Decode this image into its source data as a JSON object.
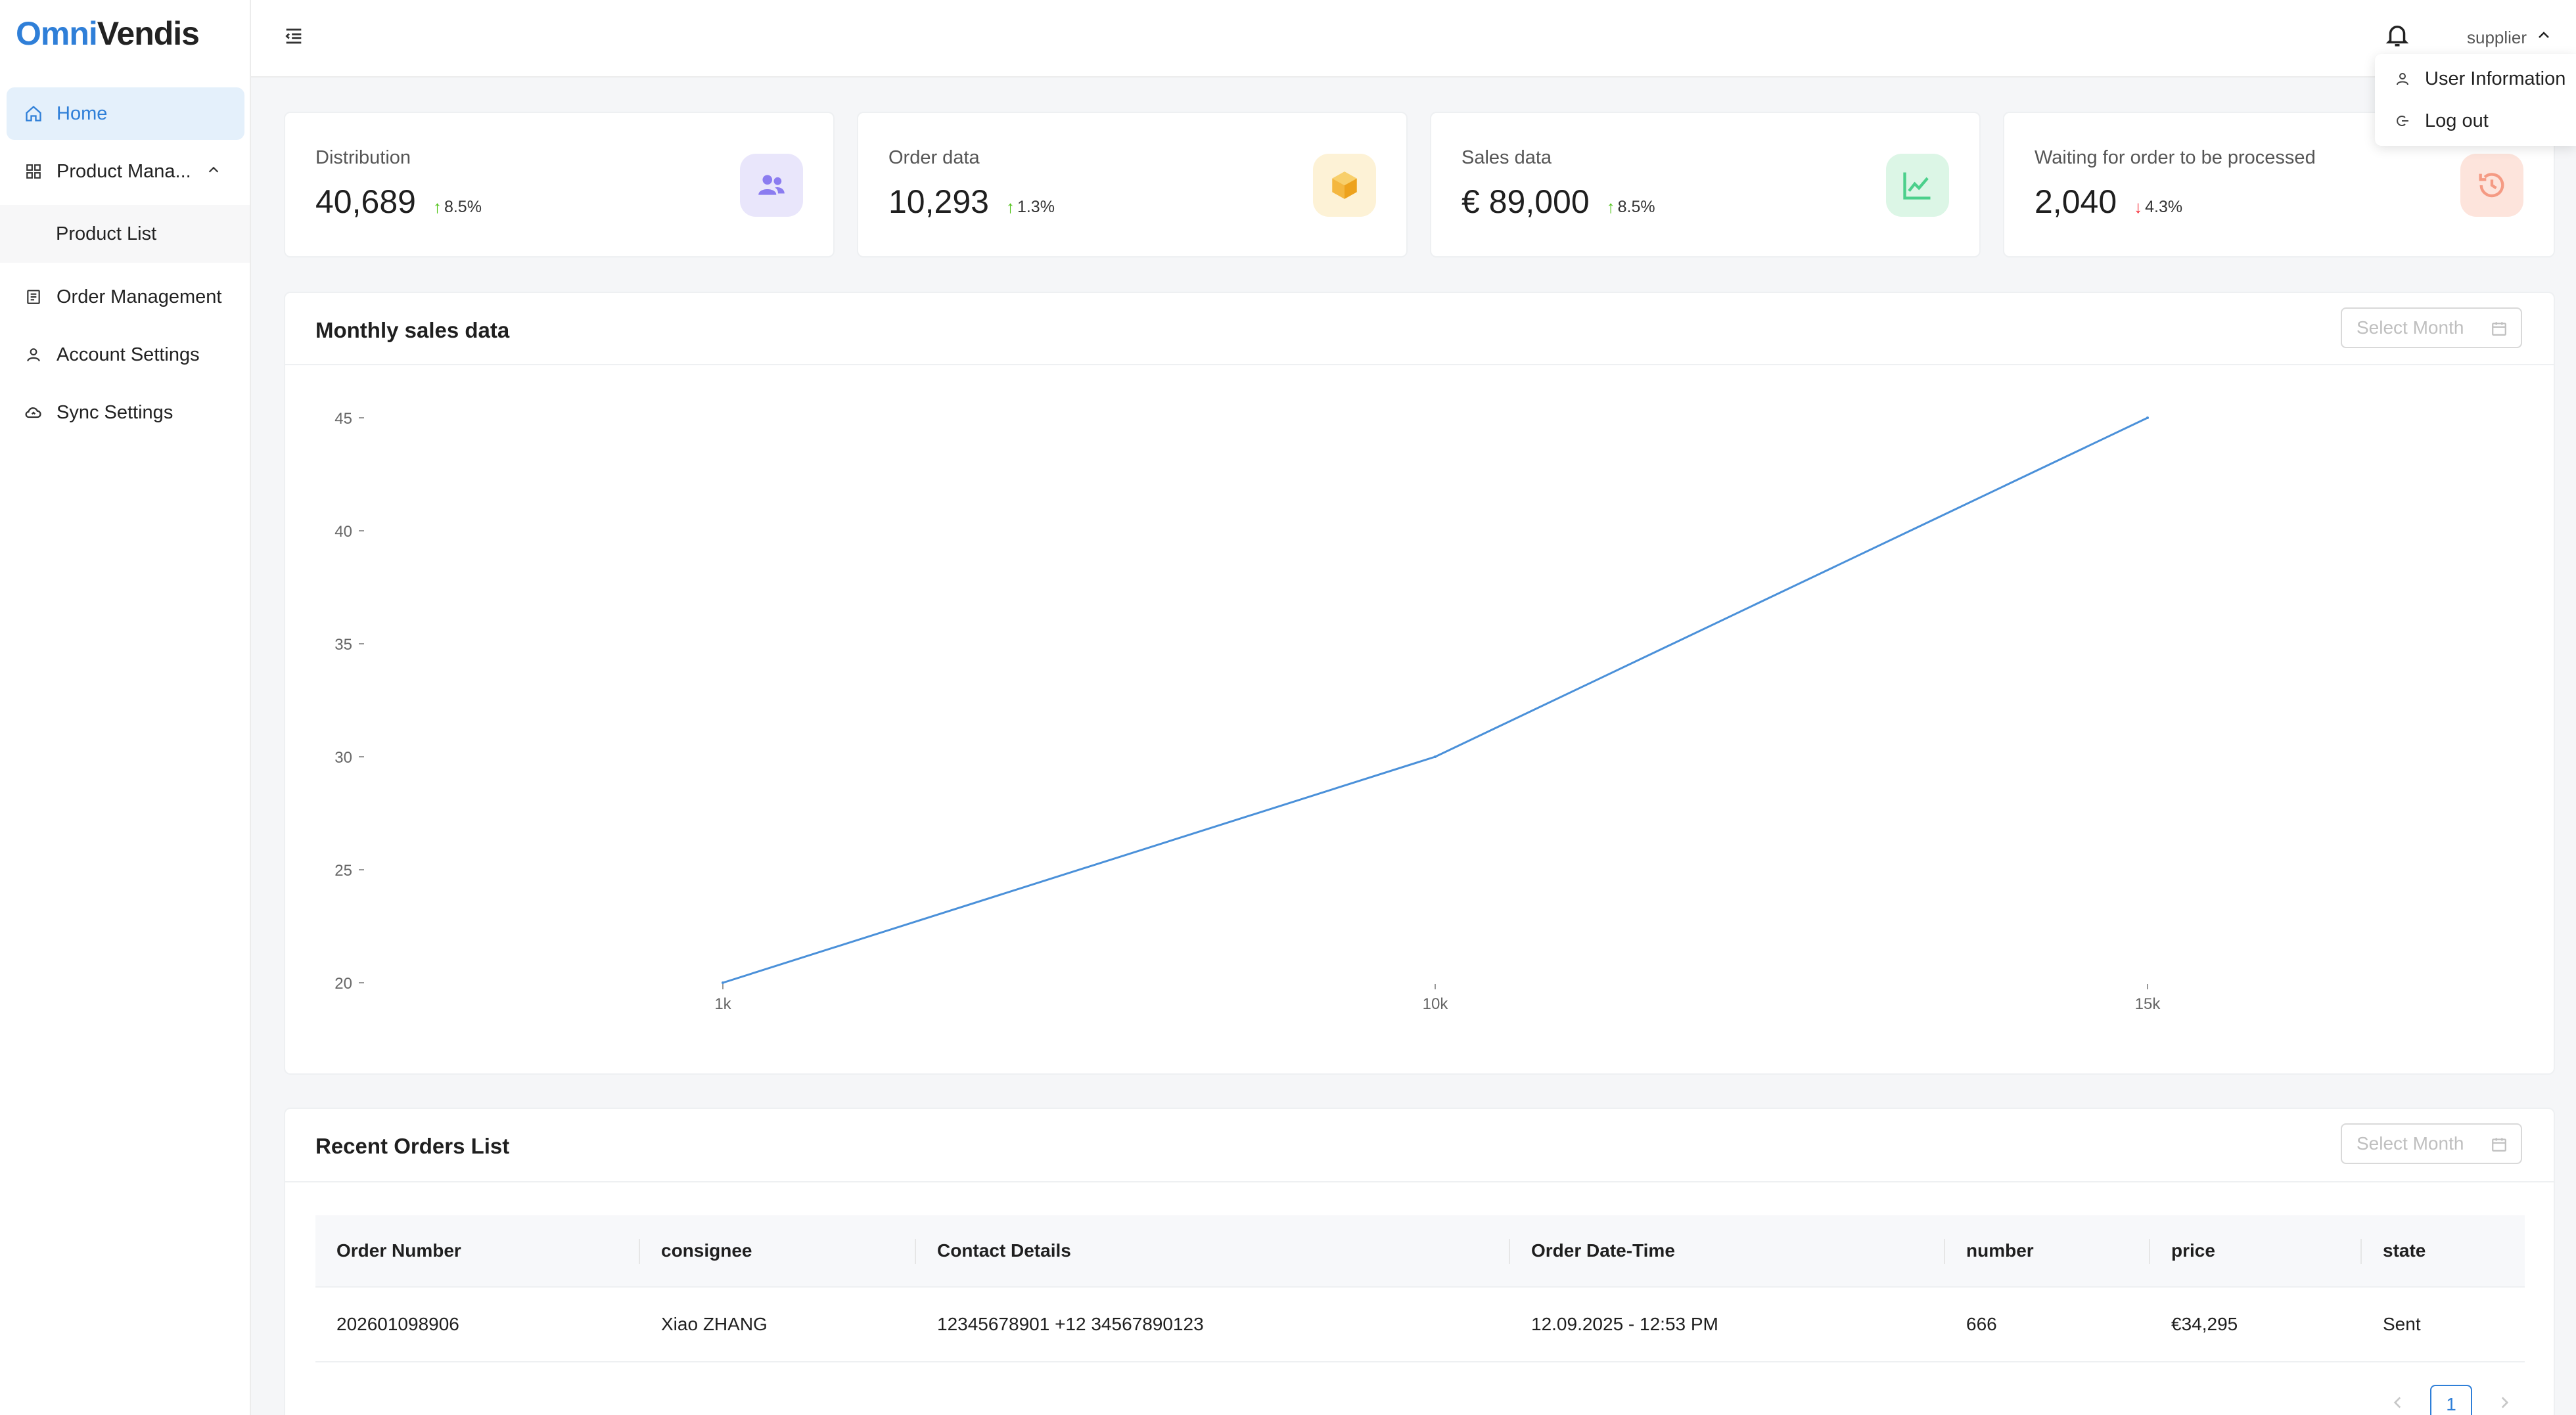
{
  "brand": {
    "part1": "Omni",
    "part2": "Vendis"
  },
  "sidebar": {
    "items": [
      {
        "label": "Home",
        "icon": "home-icon"
      },
      {
        "label": "Product Mana...",
        "icon": "grid-icon"
      },
      {
        "label": "Product List"
      },
      {
        "label": "Order Management",
        "icon": "document-icon"
      },
      {
        "label": "Account Settings",
        "icon": "user-icon"
      },
      {
        "label": "Sync Settings",
        "icon": "cloud-sync-icon"
      }
    ]
  },
  "header": {
    "user": "supplier",
    "dropdown": [
      {
        "label": "User Information",
        "icon": "user-icon"
      },
      {
        "label": "Log out",
        "icon": "logout-icon"
      }
    ]
  },
  "stats": [
    {
      "label": "Distribution",
      "value": "40,689",
      "delta": "8.5%",
      "direction": "up",
      "icon": "users-icon",
      "bg": "#e9e6fb",
      "fg": "#8b7cf0"
    },
    {
      "label": "Order data",
      "value": "10,293",
      "delta": "1.3%",
      "direction": "up",
      "icon": "box-icon",
      "bg": "#fdf2d6",
      "fg": "#f4b740"
    },
    {
      "label": "Sales data",
      "value": "€ 89,000",
      "delta": "8.5%",
      "direction": "up",
      "icon": "chart-line-icon",
      "bg": "#dcf6e6",
      "fg": "#4bd08b"
    },
    {
      "label": "Waiting for order to be processed",
      "value": "2,040",
      "delta": "4.3%",
      "direction": "down",
      "icon": "history-icon",
      "bg": "#fde4dc",
      "fg": "#f59a83"
    }
  ],
  "sales_panel": {
    "title": "Monthly sales data",
    "month_placeholder": "Select Month"
  },
  "chart_data": {
    "type": "line",
    "x": [
      "1k",
      "10k",
      "15k"
    ],
    "series": [
      {
        "values": [
          20,
          30,
          45
        ]
      }
    ],
    "yticks": [
      20,
      25,
      30,
      35,
      40,
      45
    ],
    "ylim": [
      20,
      45
    ],
    "grid": false,
    "line_color": "#4a90d9"
  },
  "orders_panel": {
    "title": "Recent Orders List",
    "month_placeholder": "Select Month",
    "columns": [
      "Order Number",
      "consignee",
      "Contact Details",
      "Order Date-Time",
      "number",
      "price",
      "state"
    ],
    "rows": [
      [
        "202601098906",
        "Xiao ZHANG",
        "12345678901 +12 34567890123",
        "12.09.2025 - 12:53 PM",
        "666",
        "€34,295",
        "Sent"
      ]
    ],
    "page": "1"
  }
}
